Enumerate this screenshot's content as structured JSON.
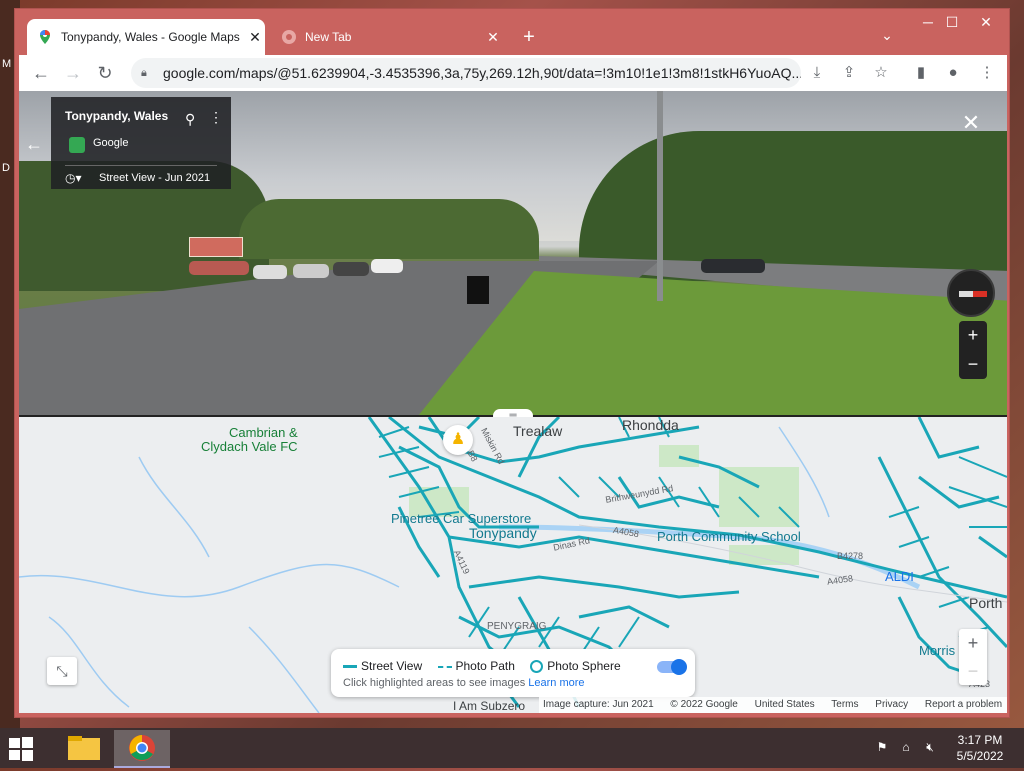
{
  "desktop": {
    "letters": [
      "M",
      "D"
    ]
  },
  "browser": {
    "tabs": [
      {
        "label": "Tonypandy, Wales - Google Maps",
        "icon": "google-maps-pin-icon",
        "active": true
      },
      {
        "label": "New Tab",
        "icon": "chrome-icon",
        "active": false
      }
    ],
    "url": "google.com/maps/@51.6239904,-3.4535396,3a,75y,269.12h,90t/data=!3m10!1e1!3m8!1stkH6YuoAQ..."
  },
  "streetview": {
    "place_title": "Tonypandy, Wales",
    "source": "Google",
    "date_label": "Street View - Jun 2021"
  },
  "map": {
    "labels": {
      "cambrian": "Cambrian &",
      "clydach": "Clydach Vale FC",
      "trealaw": "Trealaw",
      "rhondda": "Rhondda",
      "pinetree": "Pinetree Car Superstore",
      "tonypandy": "Tonypandy",
      "porth_school": "Porth Community School",
      "aldi": "ALDI",
      "porth": "Porth",
      "morris": "Morris",
      "penygraig": "PENYGRAIG",
      "subzero": "I Am Subzero",
      "miskin": "Miskin Rd",
      "brithweunydd": "Brithweunydd Rd",
      "dinas": "Dinas Rd",
      "a4058a": "A4058",
      "a4058b": "A4058",
      "a4119": "A4119",
      "b4278": "B4278",
      "a4233": "A423",
      "b58": "B8"
    },
    "legend": {
      "street_view": "Street View",
      "photo_path": "Photo Path",
      "photo_sphere": "Photo Sphere",
      "hint": "Click highlighted areas to see images",
      "learn_more": "Learn more"
    },
    "attribution": {
      "capture": "Image capture: Jun 2021",
      "copyright": "© 2022 Google",
      "country": "United States",
      "terms": "Terms",
      "privacy": "Privacy",
      "report": "Report a problem"
    },
    "colors": {
      "coverage": "#19a6b7",
      "background": "#eceef0"
    }
  },
  "taskbar": {
    "time": "3:17 PM",
    "date": "5/5/2022"
  }
}
